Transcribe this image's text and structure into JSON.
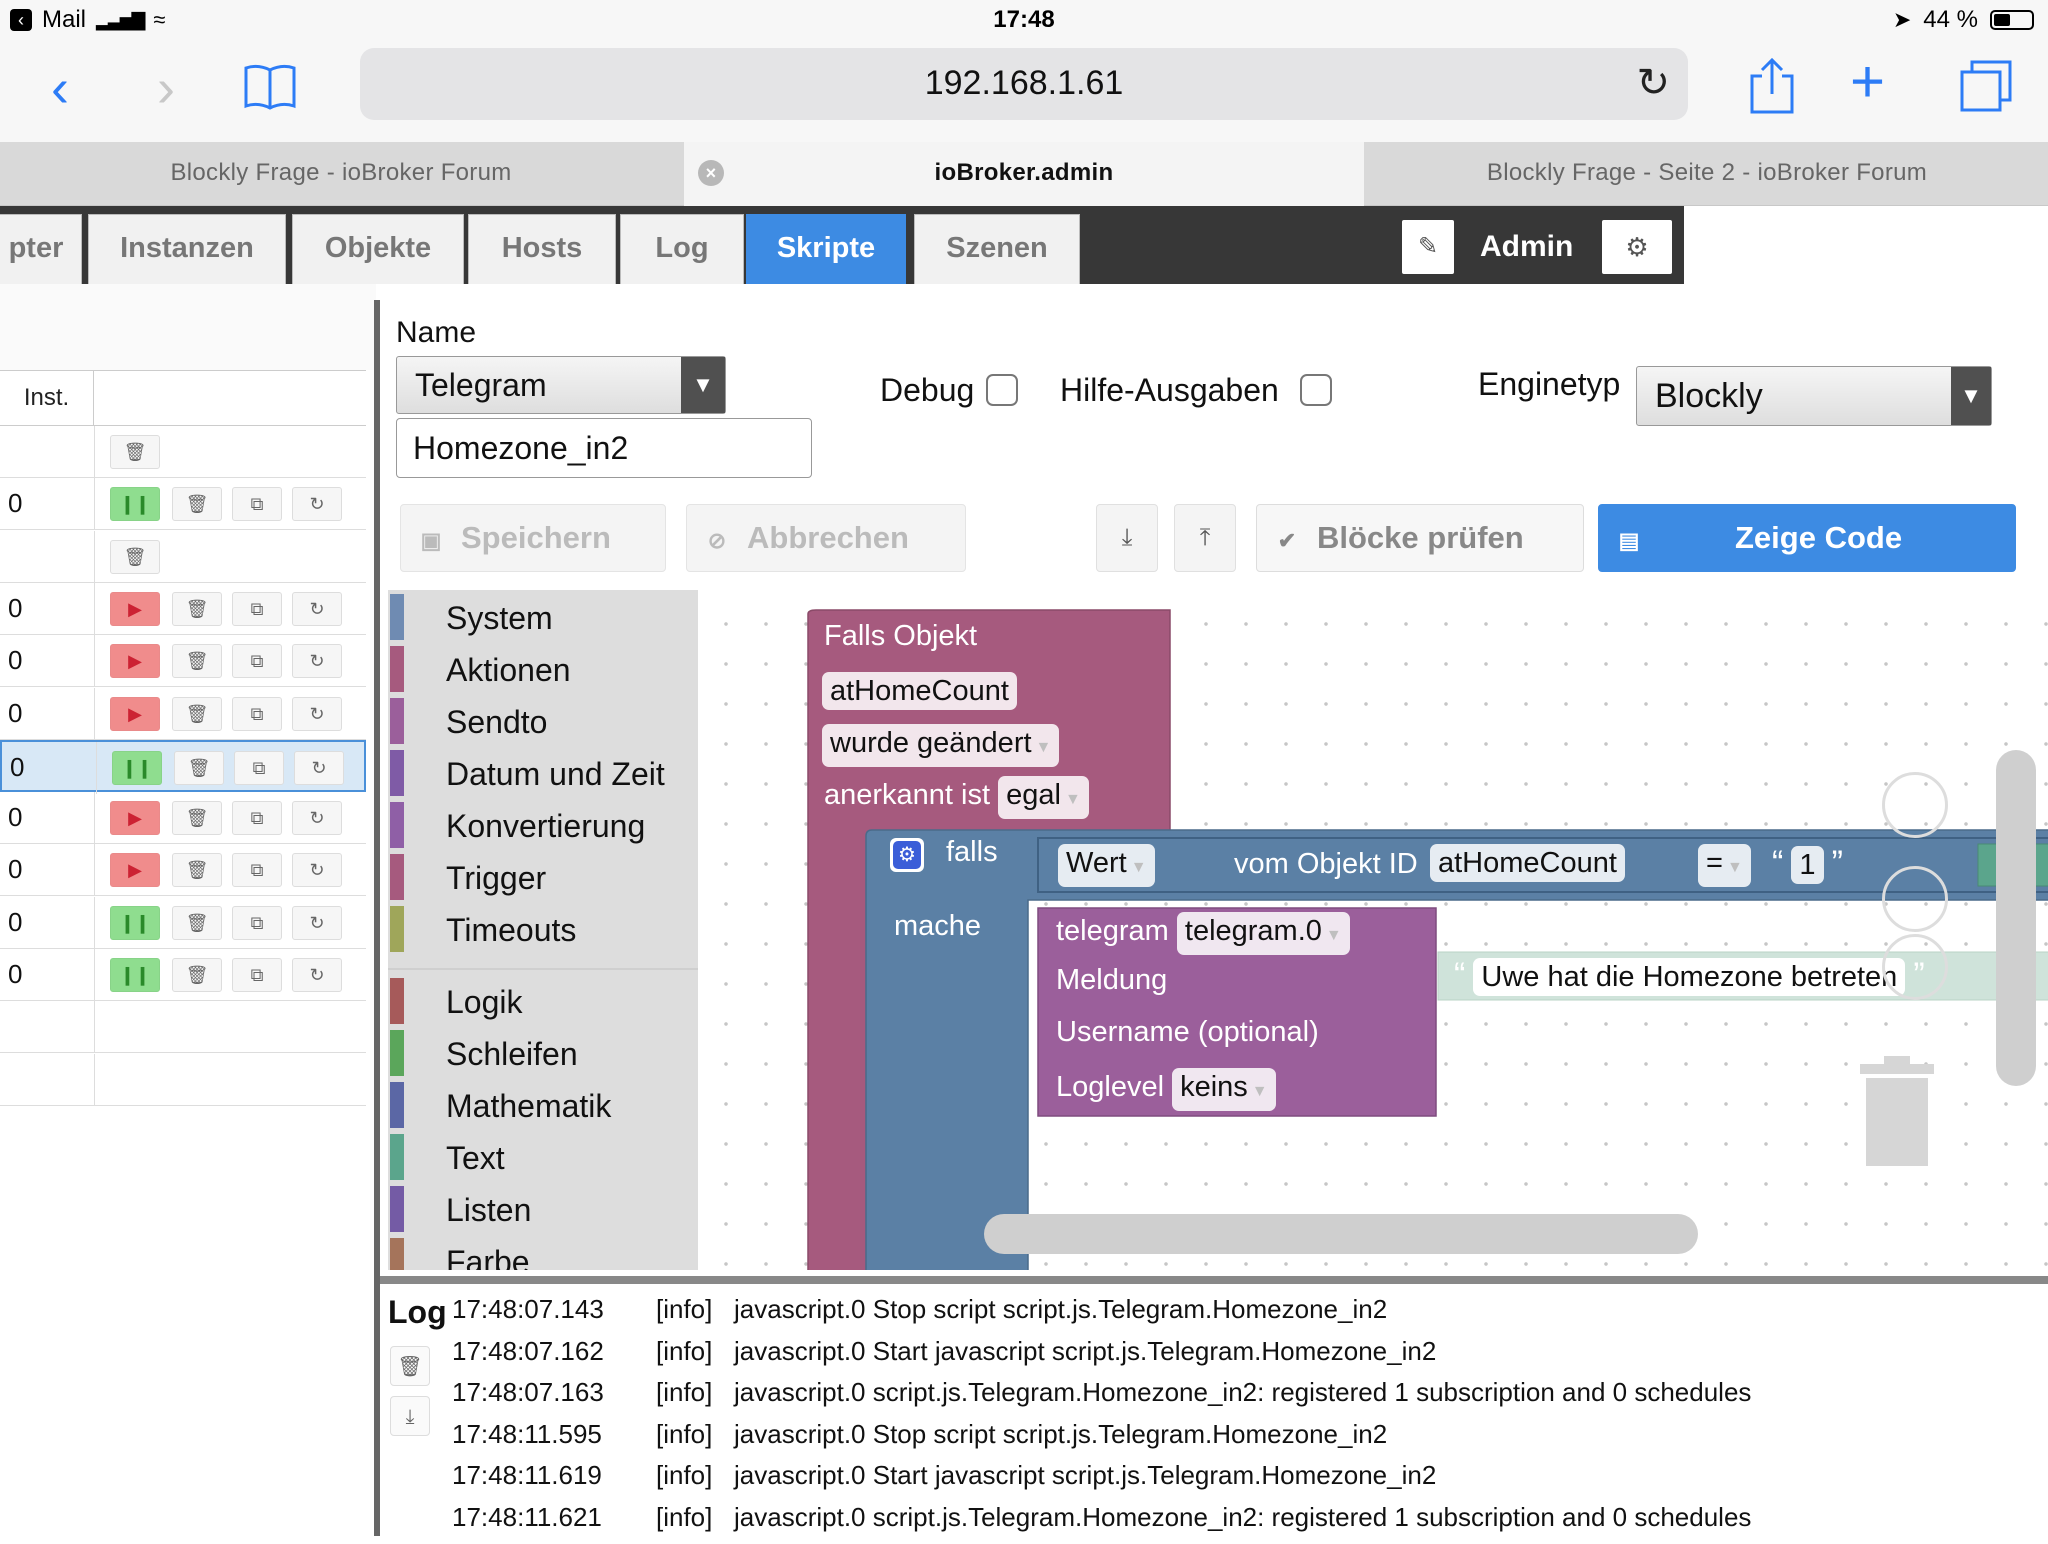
{
  "status": {
    "carrier": "Mail",
    "time": "17:48",
    "battery": "44 %",
    "battery_level": 0.44
  },
  "safari": {
    "url": "192.168.1.61"
  },
  "tabs": [
    {
      "label": "Blockly Frage - ioBroker Forum"
    },
    {
      "label": "ioBroker.admin"
    },
    {
      "label": "Blockly Frage - Seite 2 - ioBroker Forum"
    }
  ],
  "admin_tabs": [
    "pter",
    "Instanzen",
    "Objekte",
    "Hosts",
    "Log",
    "Skripte",
    "Szenen"
  ],
  "admin_user": "Admin",
  "script_list": {
    "header": "Inst.",
    "rows": [
      {
        "inst": "",
        "type": "folder"
      },
      {
        "inst": "0",
        "type": "script",
        "state": "running"
      },
      {
        "inst": "",
        "type": "folder"
      },
      {
        "inst": "0",
        "type": "script",
        "state": "stopped"
      },
      {
        "inst": "0",
        "type": "script",
        "state": "stopped"
      },
      {
        "inst": "0",
        "type": "script",
        "state": "stopped"
      },
      {
        "inst": "0",
        "type": "script",
        "state": "running",
        "selected": true
      },
      {
        "inst": "0",
        "type": "script",
        "state": "stopped"
      },
      {
        "inst": "0",
        "type": "script",
        "state": "stopped"
      },
      {
        "inst": "0",
        "type": "script",
        "state": "running"
      },
      {
        "inst": "0",
        "type": "script",
        "state": "running"
      },
      {
        "inst": "",
        "type": "empty"
      },
      {
        "inst": "",
        "type": "empty"
      }
    ]
  },
  "editor": {
    "name_label": "Name",
    "folder_value": "Telegram",
    "name_value": "Homezone_in2",
    "debug_label": "Debug",
    "hints_label": "Hilfe-Ausgaben",
    "engine_label": "Enginetyp",
    "engine_value": "Blockly",
    "save_label": "Speichern",
    "cancel_label": "Abbrechen",
    "check_label": "Blöcke prüfen",
    "show_code_label": "Zeige Code"
  },
  "toolbox": {
    "categories": [
      {
        "label": "System",
        "color": "#6f8bb2"
      },
      {
        "label": "Aktionen",
        "color": "#a65a7e"
      },
      {
        "label": "Sendto",
        "color": "#9b5f9b"
      },
      {
        "label": "Datum und Zeit",
        "color": "#7f5ba6"
      },
      {
        "label": "Konvertierung",
        "color": "#8f5fa6"
      },
      {
        "label": "Trigger",
        "color": "#a65a7e"
      },
      {
        "label": "Timeouts",
        "color": "#9fa65a"
      },
      {
        "label": "Logik",
        "color": "#a65a5a"
      },
      {
        "label": "Schleifen",
        "color": "#5ba65b"
      },
      {
        "label": "Mathematik",
        "color": "#5b67a5"
      },
      {
        "label": "Text",
        "color": "#5ba58c"
      },
      {
        "label": "Listen",
        "color": "#745ba5"
      },
      {
        "label": "Farbe",
        "color": "#a5745b"
      }
    ]
  },
  "blocks": {
    "trigger_title": "Falls Objekt",
    "trigger_object": "atHomeCount",
    "trigger_mode": "wurde geändert",
    "ack_label": "anerkannt ist",
    "ack_value": "egal",
    "if_label": "falls",
    "do_label": "mache",
    "value_field": "Wert",
    "object_id_label": "vom Objekt ID",
    "object_id": "atHomeCount",
    "operator": "=",
    "compare_value": "1",
    "telegram_label": "telegram",
    "telegram_instance": "telegram.0",
    "message_label": "Meldung",
    "message_text": "Uwe hat die Homezone betreten",
    "username_label": "Username (optional)",
    "loglevel_label": "Loglevel",
    "loglevel_value": "keins",
    "colors": {
      "trigger": "#a65a7e",
      "logic": "#5b80a5",
      "telegram": "#9b5f9b",
      "text": "#5ba58c",
      "text_light": "#cfe3da"
    }
  },
  "log": {
    "title": "Log",
    "rows": [
      {
        "time": "17:48:07.143",
        "severity": "[info]",
        "message": "javascript.0 Stop script script.js.Telegram.Homezone_in2"
      },
      {
        "time": "17:48:07.162",
        "severity": "[info]",
        "message": "javascript.0 Start javascript script.js.Telegram.Homezone_in2"
      },
      {
        "time": "17:48:07.163",
        "severity": "[info]",
        "message": "javascript.0 script.js.Telegram.Homezone_in2: registered 1 subscription and 0 schedules"
      },
      {
        "time": "17:48:11.595",
        "severity": "[info]",
        "message": "javascript.0 Stop script script.js.Telegram.Homezone_in2"
      },
      {
        "time": "17:48:11.619",
        "severity": "[info]",
        "message": "javascript.0 Start javascript script.js.Telegram.Homezone_in2"
      },
      {
        "time": "17:48:11.621",
        "severity": "[info]",
        "message": "javascript.0 script.js.Telegram.Homezone_in2: registered 1 subscription and 0 schedules"
      }
    ]
  }
}
